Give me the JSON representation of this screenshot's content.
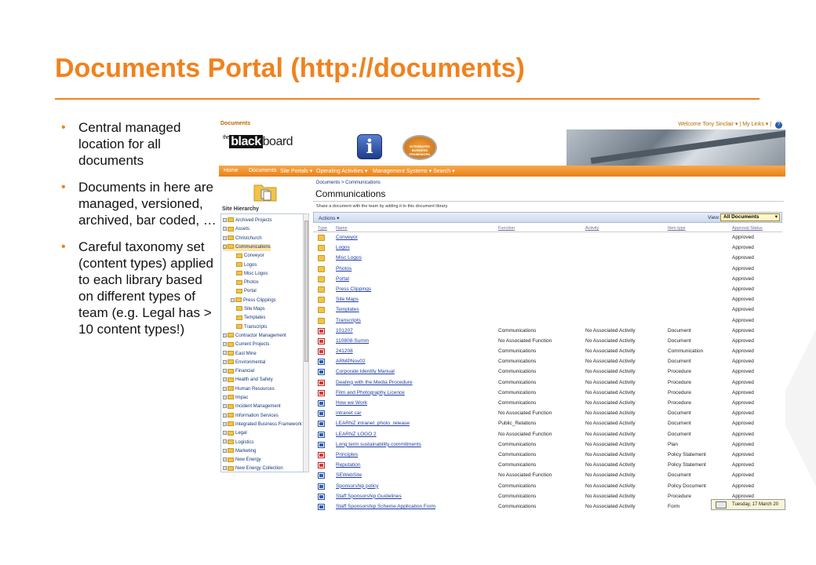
{
  "slide": {
    "title": "Documents Portal (http://documents)",
    "bullets": [
      "Central managed location for all documents",
      "Documents in here are managed, versioned, archived, bar coded, …",
      "Careful taxonomy set (content types) applied to each library based on different types of team (e.g. Legal has > 10 content types!)"
    ]
  },
  "colors": {
    "accent": "#f0821e",
    "nav": "#e8821a",
    "link": "#1f3fa0"
  },
  "sharepoint": {
    "site_title": "Documents",
    "welcome": "Welcome Tony Sinclair",
    "my_links": "My Links",
    "logo_the": "the",
    "logo_black": "black",
    "logo_board": "board",
    "info_icon_letter": "i",
    "ibf_logo_text": "INTEGRATED BUSINESS FRAMEWORK",
    "nav": [
      "Home",
      "Documents",
      "Site Portals",
      "Operating Activities",
      "Management Systems",
      "Search"
    ],
    "breadcrumb": "Documents > Communications",
    "page_heading": "Communications",
    "description": "Share a document with the team by adding it to this document library.",
    "actions_label": "Actions",
    "view_label": "View:",
    "view_value": "All Documents",
    "site_hierarchy_label": "Site Hierarchy",
    "tree": [
      {
        "label": "Archived Projects",
        "level": 0,
        "pm": "+"
      },
      {
        "label": "Assets",
        "level": 0,
        "pm": "+"
      },
      {
        "label": "Christchurch",
        "level": 0,
        "pm": "+"
      },
      {
        "label": "Communications",
        "level": 0,
        "pm": "-",
        "selected": true
      },
      {
        "label": "Conveyor",
        "level": 1
      },
      {
        "label": "Logos",
        "level": 1
      },
      {
        "label": "Misc Logos",
        "level": 1
      },
      {
        "label": "Photos",
        "level": 1
      },
      {
        "label": "Portal",
        "level": 1
      },
      {
        "label": "Press Clippings",
        "level": 1,
        "pm": "+"
      },
      {
        "label": "Site Maps",
        "level": 1
      },
      {
        "label": "Templates",
        "level": 1
      },
      {
        "label": "Transcripts",
        "level": 1
      },
      {
        "label": "Contractor Management",
        "level": 0,
        "pm": "+"
      },
      {
        "label": "Current Projects",
        "level": 0,
        "pm": "+"
      },
      {
        "label": "East Mine",
        "level": 0,
        "pm": "+"
      },
      {
        "label": "Environmental",
        "level": 0,
        "pm": "+"
      },
      {
        "label": "Financial",
        "level": 0,
        "pm": "+"
      },
      {
        "label": "Health and Safety",
        "level": 0,
        "pm": "+"
      },
      {
        "label": "Human Resources",
        "level": 0,
        "pm": "+"
      },
      {
        "label": "Impac",
        "level": 0,
        "pm": "+"
      },
      {
        "label": "Incident Management",
        "level": 0,
        "pm": "+"
      },
      {
        "label": "Information Services",
        "level": 0,
        "pm": "+"
      },
      {
        "label": "Integrated Business Framework",
        "level": 0,
        "pm": "+"
      },
      {
        "label": "Legal",
        "level": 0,
        "pm": "+"
      },
      {
        "label": "Logistics",
        "level": 0,
        "pm": "+"
      },
      {
        "label": "Marketing",
        "level": 0,
        "pm": "+"
      },
      {
        "label": "New Energy",
        "level": 0,
        "pm": "+"
      },
      {
        "label": "New Energy Collection",
        "level": 0,
        "pm": "+"
      }
    ],
    "columns": [
      "Type",
      "Name",
      "Function",
      "Activity",
      "Item type",
      "Approval Status"
    ],
    "rows": [
      {
        "icon": "folder",
        "name": "Conveyor",
        "function": "",
        "activity": "",
        "itemtype": "",
        "status": "Approved"
      },
      {
        "icon": "folder",
        "name": "Logos",
        "function": "",
        "activity": "",
        "itemtype": "",
        "status": "Approved"
      },
      {
        "icon": "folder",
        "name": "Misc Logos",
        "function": "",
        "activity": "",
        "itemtype": "",
        "status": "Approved"
      },
      {
        "icon": "folder",
        "name": "Photos",
        "function": "",
        "activity": "",
        "itemtype": "",
        "status": "Approved"
      },
      {
        "icon": "folder",
        "name": "Portal",
        "function": "",
        "activity": "",
        "itemtype": "",
        "status": "Approved"
      },
      {
        "icon": "folder",
        "name": "Press Clippings",
        "function": "",
        "activity": "",
        "itemtype": "",
        "status": "Approved"
      },
      {
        "icon": "folder",
        "name": "Site Maps",
        "function": "",
        "activity": "",
        "itemtype": "",
        "status": "Approved"
      },
      {
        "icon": "folder",
        "name": "Templates",
        "function": "",
        "activity": "",
        "itemtype": "",
        "status": "Approved"
      },
      {
        "icon": "folder",
        "name": "Transcripts",
        "function": "",
        "activity": "",
        "itemtype": "",
        "status": "Approved"
      },
      {
        "icon": "pdf",
        "name": "101207",
        "function": "Communications",
        "activity": "No Associated Activity",
        "itemtype": "Document",
        "status": "Approved"
      },
      {
        "icon": "pdf",
        "name": "110808-Summ",
        "function": "No Associated Function",
        "activity": "No Associated Activity",
        "itemtype": "Document",
        "status": "Approved"
      },
      {
        "icon": "pdf",
        "name": "241208",
        "function": "Communications",
        "activity": "No Associated Activity",
        "itemtype": "Communication",
        "status": "Approved"
      },
      {
        "icon": "doc",
        "name": "ARMPNov02",
        "function": "Communications",
        "activity": "No Associated Activity",
        "itemtype": "Document",
        "status": "Approved"
      },
      {
        "icon": "doc",
        "name": "Corporate Identity Manual",
        "function": "Communications",
        "activity": "No Associated Activity",
        "itemtype": "Procedure",
        "status": "Approved"
      },
      {
        "icon": "pdf",
        "name": "Dealing with the Media Procedure",
        "function": "Communications",
        "activity": "No Associated Activity",
        "itemtype": "Procedure",
        "status": "Approved"
      },
      {
        "icon": "pdf",
        "name": "Film and Photography Licence",
        "function": "Communications",
        "activity": "No Associated Activity",
        "itemtype": "Procedure",
        "status": "Approved"
      },
      {
        "icon": "doc",
        "name": "How we Work",
        "function": "Communications",
        "activity": "No Associated Activity",
        "itemtype": "Procedure",
        "status": "Approved"
      },
      {
        "icon": "doc",
        "name": "intranet car",
        "function": "No Associated Function",
        "activity": "No Associated Activity",
        "itemtype": "Document",
        "status": "Approved"
      },
      {
        "icon": "doc",
        "name": "LEARNZ intranet_photo_release",
        "function": "Public_Relations",
        "activity": "No Associated Activity",
        "itemtype": "Document",
        "status": "Approved"
      },
      {
        "icon": "doc",
        "name": "LEARNZ LOGO 2",
        "function": "No Associated Function",
        "activity": "No Associated Activity",
        "itemtype": "Document",
        "status": "Approved"
      },
      {
        "icon": "doc",
        "name": "Long term sustainability commitments",
        "function": "Communications",
        "activity": "No Associated Activity",
        "itemtype": "Plan",
        "status": "Approved"
      },
      {
        "icon": "pdf",
        "name": "Principles",
        "function": "Communications",
        "activity": "No Associated Activity",
        "itemtype": "Policy Statement",
        "status": "Approved"
      },
      {
        "icon": "pdf",
        "name": "Reputation",
        "function": "Communications",
        "activity": "No Associated Activity",
        "itemtype": "Policy Statement",
        "status": "Approved"
      },
      {
        "icon": "doc",
        "name": "SEWebSite",
        "function": "No Associated Function",
        "activity": "No Associated Activity",
        "itemtype": "Document",
        "status": "Approved"
      },
      {
        "icon": "doc",
        "name": "Sponsorship policy",
        "function": "Communications",
        "activity": "No Associated Activity",
        "itemtype": "Policy Document",
        "status": "Approved"
      },
      {
        "icon": "doc",
        "name": "Staff Sponsorship Guidelines",
        "function": "Communications",
        "activity": "No Associated Activity",
        "itemtype": "Procedure",
        "status": "Approved"
      },
      {
        "icon": "doc",
        "name": "Staff Sponsorship Scheme Application Form",
        "function": "Communications",
        "activity": "No Associated Activity",
        "itemtype": "Form",
        "status": "Approved"
      }
    ],
    "taskbar_date": "Tuesday, 17 March 20"
  }
}
